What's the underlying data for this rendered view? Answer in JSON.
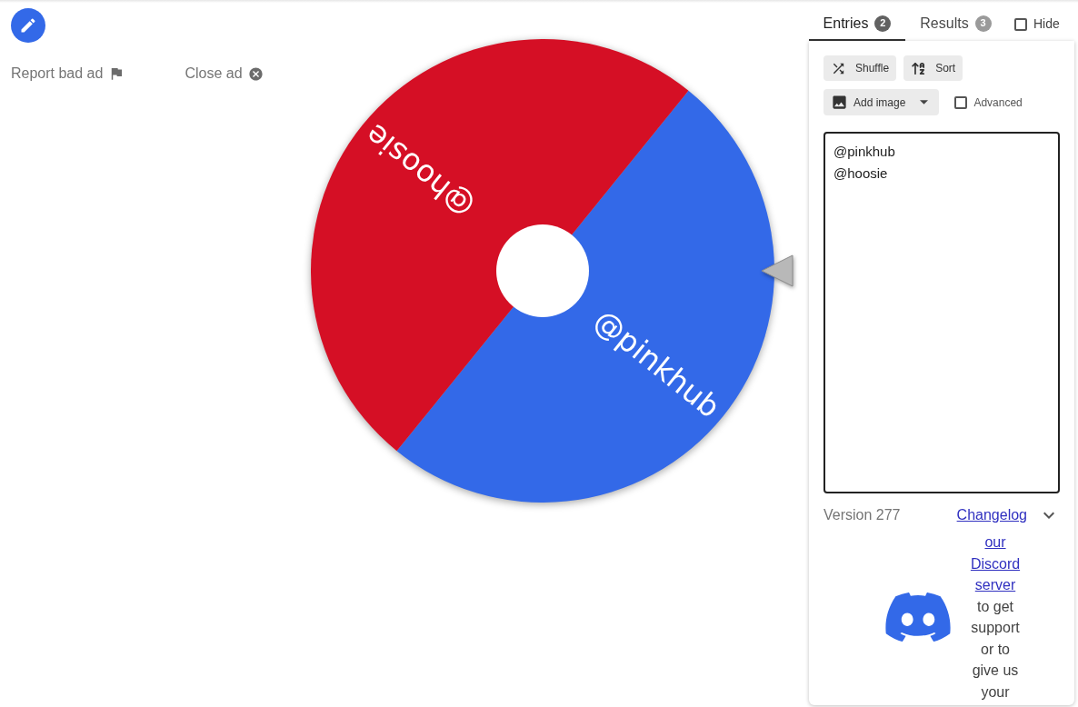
{
  "ad_links": [
    {
      "kind": "report",
      "label": "Report bad ad"
    },
    {
      "kind": "close",
      "label": "Close ad"
    }
  ],
  "wheel": {
    "segments": [
      {
        "label": "@pinkhub",
        "color": "#3369e8"
      },
      {
        "label": "@hoosie",
        "color": "#d50f25"
      }
    ]
  },
  "panel": {
    "tabs": [
      {
        "label": "Entries",
        "count": "2",
        "selected": true
      },
      {
        "label": "Results",
        "count": "3",
        "selected": false
      }
    ],
    "hide": {
      "label": "Hide",
      "checked": false
    },
    "actions": [
      {
        "kind": "shuffle",
        "label": "Shuffle"
      },
      {
        "kind": "sort",
        "label": "Sort"
      },
      {
        "kind": "image",
        "label": "Add image"
      }
    ],
    "advanced": {
      "label": "Advanced",
      "checked": false
    },
    "entries": "@pinkhub\n@hoosie",
    "version": "Version 277",
    "changelog": "Changelog",
    "discord": {
      "link": "our Discord server",
      "text": "to get support or to give us your"
    }
  }
}
